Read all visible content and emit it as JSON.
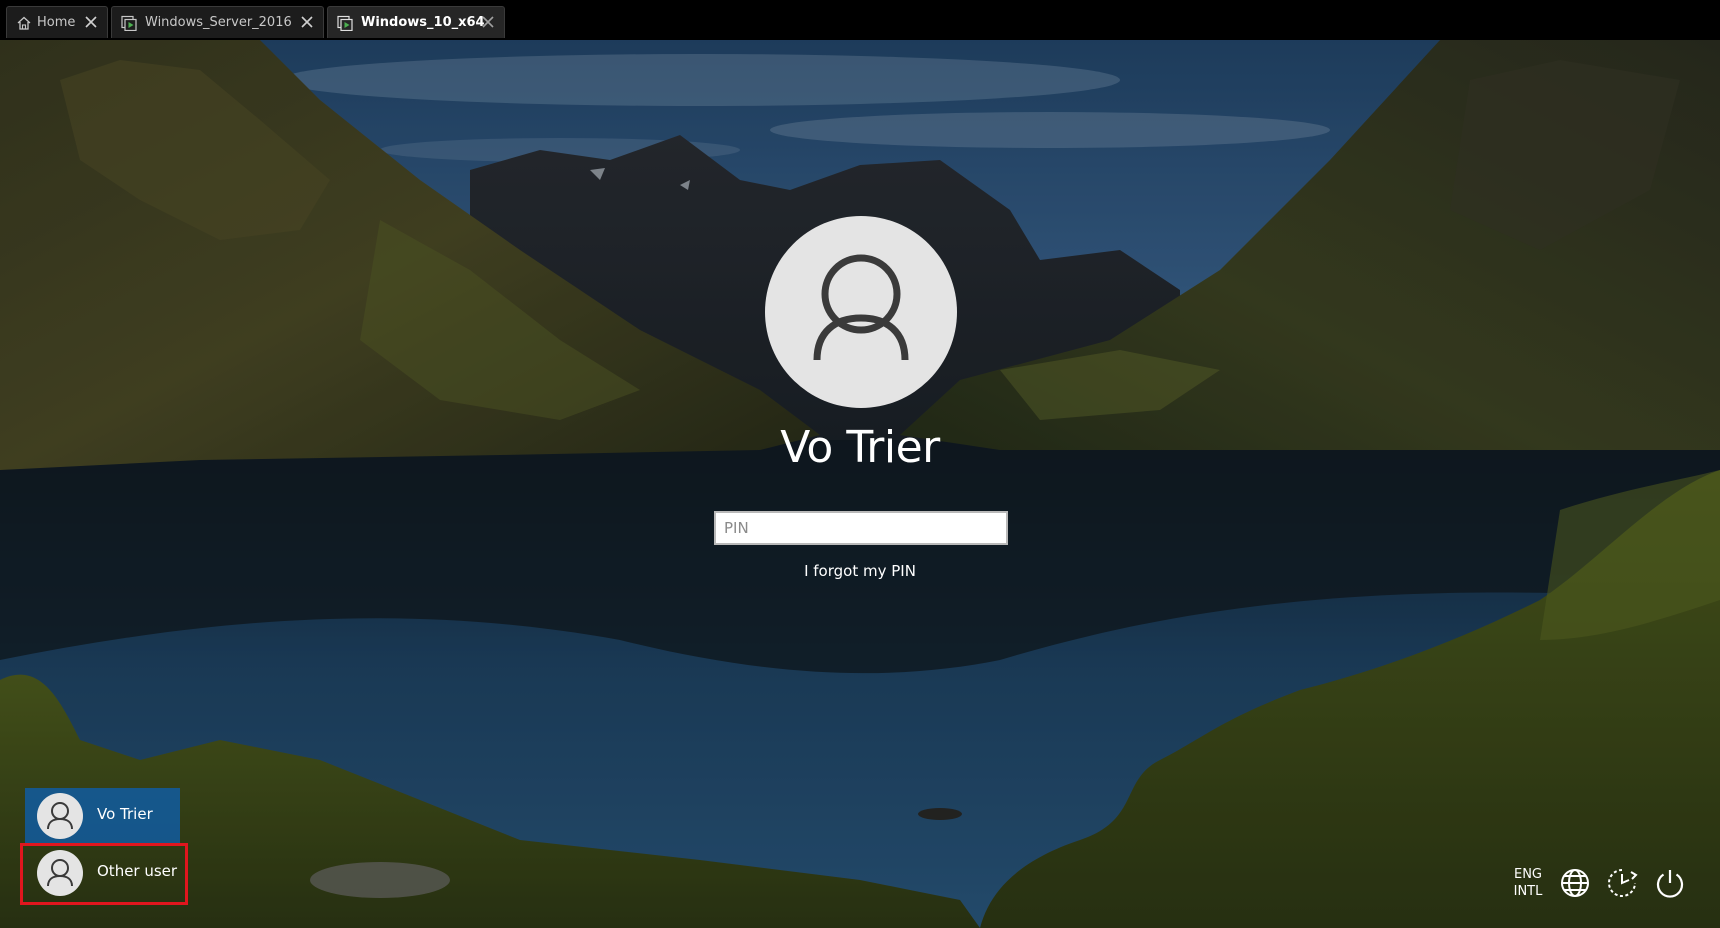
{
  "tabs": [
    {
      "label": "Home",
      "icon": "home-icon",
      "active": false
    },
    {
      "label": "Windows_Server_2016",
      "icon": "vm-icon",
      "active": false
    },
    {
      "label": "Windows_10_x64",
      "icon": "vm-icon",
      "active": true
    }
  ],
  "lock_screen": {
    "user_name": "Vo Trier",
    "pin_placeholder": "PIN",
    "pin_value": "",
    "forgot_pin_label": "I forgot my PIN"
  },
  "user_list": [
    {
      "label": "Vo Trier",
      "selected": true
    },
    {
      "label": "Other user",
      "selected": false
    }
  ],
  "system": {
    "language_line1": "ENG",
    "language_line2": "INTL",
    "network_icon": "globe-network-icon",
    "accessibility_icon": "ease-of-access-icon",
    "power_icon": "power-icon"
  },
  "colors": {
    "selected_user_bg": "#105ca0",
    "highlight_border": "#e0161e",
    "vm_icon_accent": "#4caf50"
  }
}
